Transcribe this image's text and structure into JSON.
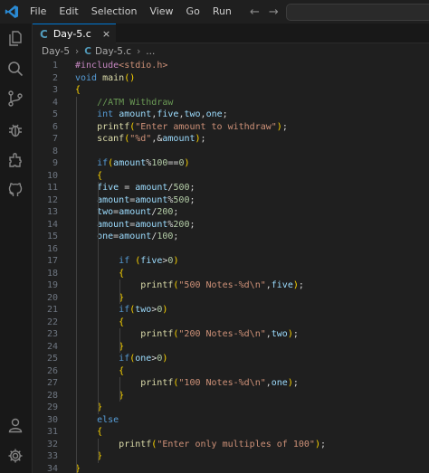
{
  "menu": [
    "File",
    "Edit",
    "Selection",
    "View",
    "Go",
    "Run"
  ],
  "tab": {
    "label": "Day-5.c",
    "close": "×",
    "lang_glyph": "C"
  },
  "breadcrumb": {
    "folder": "Day-5",
    "file": "Day-5.c",
    "more": "..."
  },
  "nav": {
    "back": "←",
    "forward": "→"
  },
  "code_lines": [
    "#include<stdio.h>",
    "void main()",
    "{",
    "    //ATM Withdraw",
    "    int amount,five,two,one;",
    "    printf(\"Enter amount to withdraw\");",
    "    scanf(\"%d\",&amount);",
    "",
    "    if(amount%100==0)",
    "    {",
    "    five = amount/500;",
    "    amount=amount%500;",
    "    two=amount/200;",
    "    amount=amount%200;",
    "    one=amount/100;",
    "",
    "        if (five>0)",
    "        {",
    "            printf(\"500 Notes-%d\\n\",five);",
    "        }",
    "        if(two>0)",
    "        {",
    "            printf(\"200 Notes-%d\\n\",two);",
    "        }",
    "        if(one>0)",
    "        {",
    "            printf(\"100 Notes-%d\\n\",one);",
    "        }",
    "    }",
    "    else",
    "    {",
    "        printf(\"Enter only multiples of 100\");",
    "    }",
    "}",
    ""
  ],
  "colors": {
    "accent": "#0078d4",
    "keyword": "#569cd6",
    "function": "#dcdcaa",
    "string": "#ce9178",
    "variable": "#9cdcfe",
    "comment": "#6a9955",
    "number": "#b5cea8",
    "preproc": "#c586c0"
  }
}
